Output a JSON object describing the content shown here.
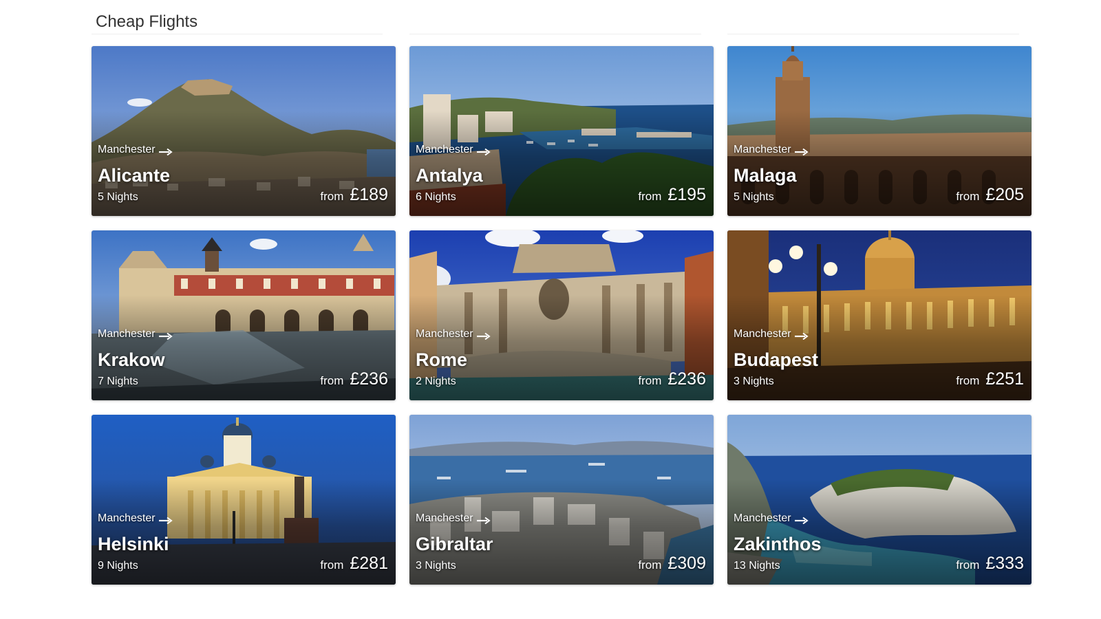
{
  "section": {
    "title": "Cheap Flights"
  },
  "cards": [
    {
      "origin": "Manchester",
      "destination": "Alicante",
      "nights": "5 Nights",
      "from_label": "from",
      "price": "£189",
      "image": "alicante-hilltop-castle-photo"
    },
    {
      "origin": "Manchester",
      "destination": "Antalya",
      "nights": "6 Nights",
      "from_label": "from",
      "price": "£195",
      "image": "antalya-harbour-photo"
    },
    {
      "origin": "Manchester",
      "destination": "Malaga",
      "nights": "5 Nights",
      "from_label": "from",
      "price": "£205",
      "image": "malaga-cathedral-photo"
    },
    {
      "origin": "Manchester",
      "destination": "Krakow",
      "nights": "7 Nights",
      "from_label": "from",
      "price": "£236",
      "image": "krakow-cloth-hall-photo"
    },
    {
      "origin": "Manchester",
      "destination": "Rome",
      "nights": "2 Nights",
      "from_label": "from",
      "price": "£236",
      "image": "rome-trevi-fountain-photo"
    },
    {
      "origin": "Manchester",
      "destination": "Budapest",
      "nights": "3 Nights",
      "from_label": "from",
      "price": "£251",
      "image": "budapest-castle-night-photo"
    },
    {
      "origin": "Manchester",
      "destination": "Helsinki",
      "nights": "9 Nights",
      "from_label": "from",
      "price": "£281",
      "image": "helsinki-cathedral-photo"
    },
    {
      "origin": "Manchester",
      "destination": "Gibraltar",
      "nights": "3 Nights",
      "from_label": "from",
      "price": "£309",
      "image": "gibraltar-bay-photo"
    },
    {
      "origin": "Manchester",
      "destination": "Zakinthos",
      "nights": "13 Nights",
      "from_label": "from",
      "price": "£333",
      "image": "zakinthos-navagio-beach-photo"
    }
  ],
  "icons": {
    "route_arrow": "arrow-right-icon"
  },
  "colors": {
    "title_text": "#333333",
    "card_text": "#ffffff",
    "divider": "#eeeeee"
  }
}
